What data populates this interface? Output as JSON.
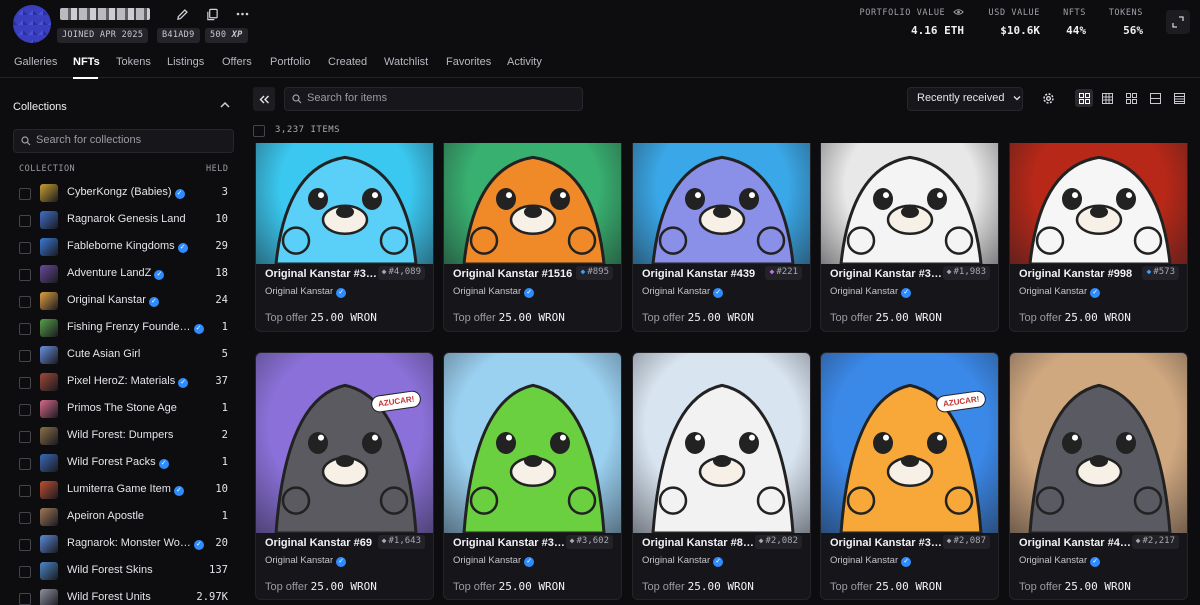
{
  "profile": {
    "joined": "JOINED APR 2025",
    "address": "B41AD9",
    "xp_value": "500",
    "xp_label": "XP"
  },
  "stats": [
    {
      "label": "PORTFOLIO VALUE",
      "value": "4.16 ETH"
    },
    {
      "label": "USD VALUE",
      "value": "$10.6K"
    },
    {
      "label": "NFTS",
      "value": "44%"
    },
    {
      "label": "TOKENS",
      "value": "56%"
    }
  ],
  "tabs": [
    "Galleries",
    "NFTs",
    "Tokens",
    "Listings",
    "Offers",
    "Portfolio",
    "Created",
    "Watchlist",
    "Favorites",
    "Activity"
  ],
  "active_tab": "NFTs",
  "sidebar": {
    "title": "Collections",
    "search_placeholder": "Search for collections",
    "col_collection": "COLLECTION",
    "col_held": "HELD",
    "collections": [
      {
        "name": "CyberKongz (Babies)",
        "held": "3",
        "verified": true,
        "color": "#c8a030"
      },
      {
        "name": "Ragnarok Genesis Land",
        "held": "10",
        "verified": false,
        "color": "#4070c8"
      },
      {
        "name": "Fableborne Kingdoms",
        "held": "29",
        "verified": true,
        "color": "#3a7ad8"
      },
      {
        "name": "Adventure LandZ",
        "held": "18",
        "verified": true,
        "color": "#6a4a9a"
      },
      {
        "name": "Original Kanstar",
        "held": "24",
        "verified": true,
        "color": "#e0a040"
      },
      {
        "name": "Fishing Frenzy Founde…",
        "held": "1",
        "verified": true,
        "color": "#58a048"
      },
      {
        "name": "Cute Asian Girl",
        "held": "5",
        "verified": false,
        "color": "#6a90e0"
      },
      {
        "name": "Pixel HeroZ: Materials",
        "held": "37",
        "verified": true,
        "color": "#a04838"
      },
      {
        "name": "Primos The Stone Age",
        "held": "1",
        "verified": false,
        "color": "#d86a8a"
      },
      {
        "name": "Wild Forest: Dumpers",
        "held": "2",
        "verified": false,
        "color": "#8a7048"
      },
      {
        "name": "Wild Forest Packs",
        "held": "1",
        "verified": true,
        "color": "#3a6ab8"
      },
      {
        "name": "Lumiterra Game Item",
        "held": "10",
        "verified": true,
        "color": "#c05030"
      },
      {
        "name": "Apeiron Apostle",
        "held": "1",
        "verified": false,
        "color": "#a07858"
      },
      {
        "name": "Ragnarok: Monster Wo…",
        "held": "20",
        "verified": true,
        "color": "#5a8ad8"
      },
      {
        "name": "Wild Forest Skins",
        "held": "137",
        "verified": false,
        "color": "#4a88c8"
      },
      {
        "name": "Wild Forest Units",
        "held": "2.97K",
        "verified": false,
        "color": "#9090a0"
      }
    ]
  },
  "toolbar": {
    "search_placeholder": "Search for items",
    "sort_value": "Recently received"
  },
  "items_count": "3,237 ITEMS",
  "cards": [
    {
      "name": "Original Kanstar #3…",
      "rank": "#4,089",
      "rank_color": "#a8a8b0",
      "collection": "Original Kanstar",
      "offer_label": "Top offer",
      "offer": "25.00 WRON",
      "bg": "#3ac8f0",
      "body": "#5ad0f8"
    },
    {
      "name": "Original Kanstar #1516",
      "rank": "#895",
      "rank_color": "#3aa0ff",
      "collection": "Original Kanstar",
      "offer_label": "Top offer",
      "offer": "25.00 WRON",
      "bg": "#38b070",
      "body": "#f08a28"
    },
    {
      "name": "Original Kanstar #439",
      "rank": "#221",
      "rank_color": "#c070f0",
      "collection": "Original Kanstar",
      "offer_label": "Top offer",
      "offer": "25.00 WRON",
      "bg": "#3aa8e8",
      "body": "#8a90e8"
    },
    {
      "name": "Original Kanstar #3…",
      "rank": "#1,983",
      "rank_color": "#a8a8b0",
      "collection": "Original Kanstar",
      "offer_label": "Top offer",
      "offer": "25.00 WRON",
      "bg": "#e8e8e8",
      "body": "#f4f4f4"
    },
    {
      "name": "Original Kanstar #998",
      "rank": "#573",
      "rank_color": "#3aa0ff",
      "collection": "Original Kanstar",
      "offer_label": "Top offer",
      "offer": "25.00 WRON",
      "bg": "#b82818",
      "body": "#f6f6f6"
    },
    {
      "name": "Original Kanstar #69",
      "rank": "#1,643",
      "rank_color": "#a8a8b0",
      "collection": "Original Kanstar",
      "offer_label": "Top offer",
      "offer": "25.00 WRON",
      "bg": "#8a70d8",
      "body": "#5a5a60"
    },
    {
      "name": "Original Kanstar #3…",
      "rank": "#3,602",
      "rank_color": "#a8a8b0",
      "collection": "Original Kanstar",
      "offer_label": "Top offer",
      "offer": "25.00 WRON",
      "bg": "#9ad0f0",
      "body": "#6ad040"
    },
    {
      "name": "Original Kanstar #8…",
      "rank": "#2,082",
      "rank_color": "#a8a8b0",
      "collection": "Original Kanstar",
      "offer_label": "Top offer",
      "offer": "25.00 WRON",
      "bg": "#d8e4f0",
      "body": "#f2f2f2"
    },
    {
      "name": "Original Kanstar #3…",
      "rank": "#2,087",
      "rank_color": "#a8a8b0",
      "collection": "Original Kanstar",
      "offer_label": "Top offer",
      "offer": "25.00 WRON",
      "bg": "#3a88e8",
      "body": "#f8a838"
    },
    {
      "name": "Original Kanstar #4…",
      "rank": "#2,217",
      "rank_color": "#a8a8b0",
      "collection": "Original Kanstar",
      "offer_label": "Top offer",
      "offer": "25.00 WRON",
      "bg": "#d0a880",
      "body": "#5a5a62"
    }
  ],
  "card_art_text": [
    "AZUCAR!",
    "AZUCAR!"
  ],
  "colors": {
    "background": "#0d0d10",
    "verified": "#2f8cff",
    "accent": "#ffffff"
  }
}
